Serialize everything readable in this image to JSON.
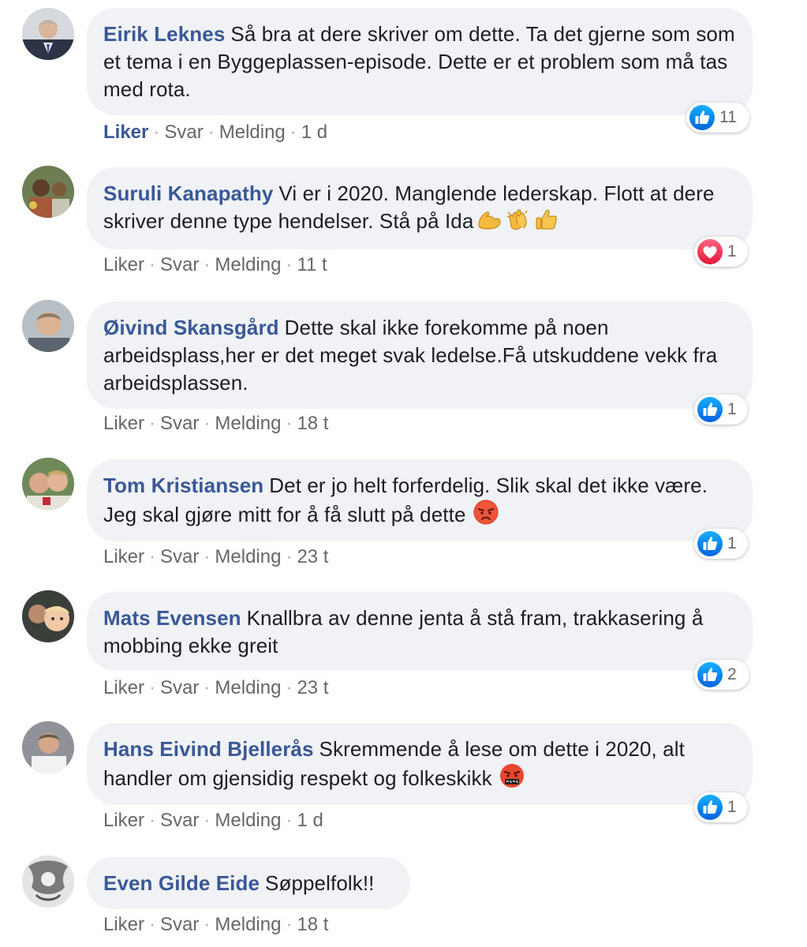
{
  "comments": [
    {
      "author": "Eirik Leknes",
      "text": "Så bra at dere skriver om dette. Ta det gjerne som som et tema i en Byggeplassen-episode. Dette er et problem som må tas med rota.",
      "actions": {
        "like": "Liker",
        "reply": "Svar",
        "message": "Melding",
        "time": "1 d",
        "liked": true
      },
      "reactions": {
        "type": "like",
        "count": "11"
      }
    },
    {
      "author": "Suruli Kanapathy",
      "text": "Vi er i 2020. Manglende lederskap. Flott at dere skriver denne type hendelser. Stå på Ida",
      "emoji": [
        "flexed-biceps-emoji",
        "clapping-hands-emoji",
        "thumbs-up-emoji"
      ],
      "actions": {
        "like": "Liker",
        "reply": "Svar",
        "message": "Melding",
        "time": "11 t"
      },
      "reactions": {
        "type": "love",
        "count": "1"
      }
    },
    {
      "author": "Øivind Skansgård",
      "text": "Dette skal ikke forekomme på noen arbeidsplass,her er det meget svak ledelse.Få utskuddene vekk fra arbeidsplassen.",
      "actions": {
        "like": "Liker",
        "reply": "Svar",
        "message": "Melding",
        "time": "18 t"
      },
      "reactions": {
        "type": "like",
        "count": "1"
      }
    },
    {
      "author": "Tom Kristiansen",
      "text": "Det er jo helt forferdelig. Slik skal det ikke være. Jeg skal gjøre mitt for å få slutt på dette",
      "emoji": [
        "angry-face-emoji"
      ],
      "actions": {
        "like": "Liker",
        "reply": "Svar",
        "message": "Melding",
        "time": "23 t"
      },
      "reactions": {
        "type": "like",
        "count": "1"
      }
    },
    {
      "author": "Mats Evensen",
      "text": "Knallbra av denne jenta å stå fram, trakkasering å mobbing ekke greit",
      "actions": {
        "like": "Liker",
        "reply": "Svar",
        "message": "Melding",
        "time": "23 t"
      },
      "reactions": {
        "type": "like",
        "count": "2"
      }
    },
    {
      "author": "Hans Eivind Bjellerås",
      "text": "Skremmende å lese om dette i 2020, alt handler om gjensidig respekt og folkeskikk",
      "emoji": [
        "cursing-face-emoji"
      ],
      "actions": {
        "like": "Liker",
        "reply": "Svar",
        "message": "Melding",
        "time": "1 d"
      },
      "reactions": {
        "type": "like",
        "count": "1"
      }
    },
    {
      "author": "Even Gilde Eide",
      "text": "Søppelfolk!!",
      "actions": {
        "like": "Liker",
        "reply": "Svar",
        "message": "Melding",
        "time": "18 t"
      }
    }
  ],
  "colors": {
    "author": "#385898",
    "bubble": "#f0f2f5",
    "like_blue": "#1877f2",
    "love_red": "#f33e58",
    "meta_gray": "#65676b"
  }
}
